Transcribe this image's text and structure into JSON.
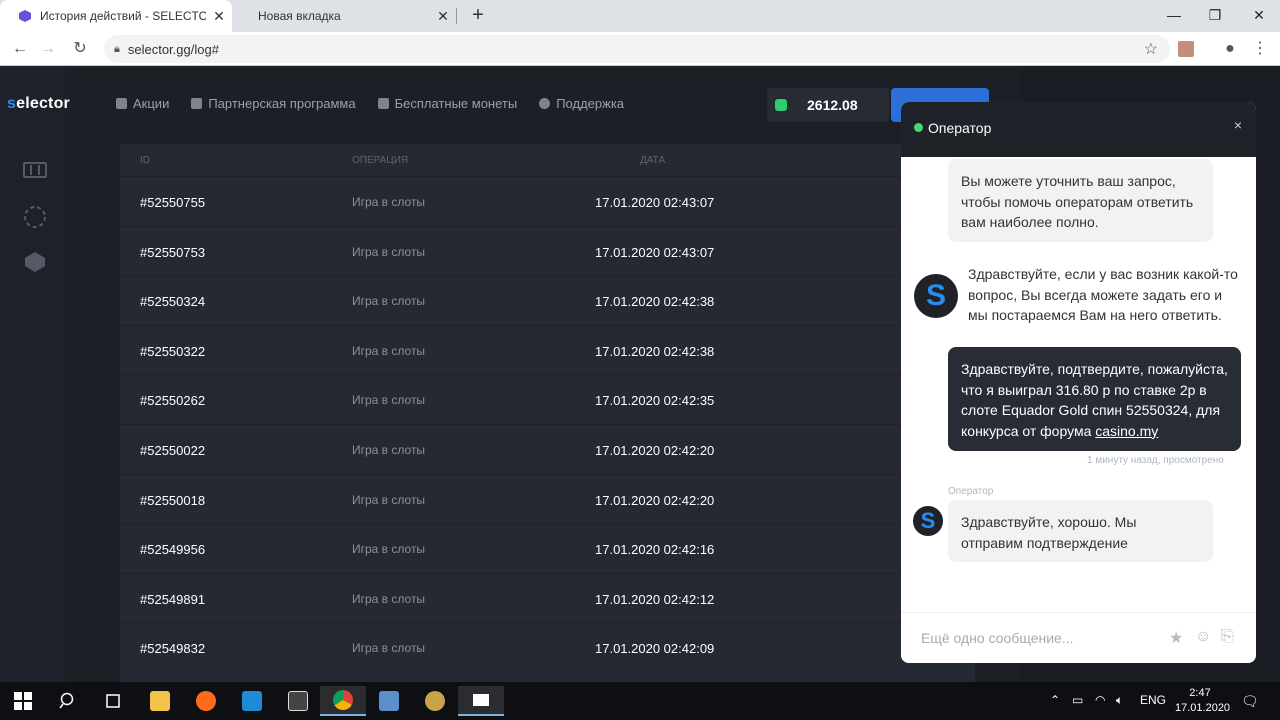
{
  "browser": {
    "tabs": [
      {
        "title": "История действий - SELECTOR.G",
        "active": true
      },
      {
        "title": "Новая вкладка",
        "active": false
      }
    ],
    "url": "selector.gg/log#"
  },
  "site": {
    "logo_prefix": "s",
    "logo_rest": "elector",
    "nav": [
      "Акции",
      "Партнерская программа",
      "Бесплатные монеты",
      "Поддержка"
    ],
    "balance": "2612.08",
    "table": {
      "headers": [
        "ID",
        "ОПЕРАЦИЯ",
        "ДАТА"
      ],
      "rows": [
        {
          "id": "#52550755",
          "op": "Игра в слоты",
          "date": "17.01.2020 02:43:07"
        },
        {
          "id": "#52550753",
          "op": "Игра в слоты",
          "date": "17.01.2020 02:43:07"
        },
        {
          "id": "#52550324",
          "op": "Игра в слоты",
          "date": "17.01.2020 02:42:38"
        },
        {
          "id": "#52550322",
          "op": "Игра в слоты",
          "date": "17.01.2020 02:42:38"
        },
        {
          "id": "#52550262",
          "op": "Игра в слоты",
          "date": "17.01.2020 02:42:35"
        },
        {
          "id": "#52550022",
          "op": "Игра в слоты",
          "date": "17.01.2020 02:42:20"
        },
        {
          "id": "#52550018",
          "op": "Игра в слоты",
          "date": "17.01.2020 02:42:20"
        },
        {
          "id": "#52549956",
          "op": "Игра в слоты",
          "date": "17.01.2020 02:42:16"
        },
        {
          "id": "#52549891",
          "op": "Игра в слоты",
          "date": "17.01.2020 02:42:12"
        },
        {
          "id": "#52549832",
          "op": "Игра в слоты",
          "date": "17.01.2020 02:42:09"
        }
      ]
    }
  },
  "chat": {
    "title": "Оператор",
    "close": "×",
    "msg1": "Вы можете уточнить ваш запрос, чтобы помочь операторам ответить вам наиболее полно.",
    "msg2": "Здравствуйте, если у вас возник какой-то вопрос, Вы всегда можете задать его и мы постараемся Вам на него ответить.",
    "msg3_text": "Здравствуйте, подтвердите, пожалуйста, что я выиграл 316.80 р по ставке 2р в слоте Equador Gold спин 52550324, для конкурса от форума ",
    "msg3_link": "casino.my",
    "msg3_meta": "1 минуту назад, просмотрено",
    "op_label": "Оператор",
    "msg4": "Здравствуйте, хорошо. Мы отправим подтверждение",
    "avatar_letter": "S",
    "input_placeholder": "Ещё одно сообщение..."
  },
  "taskbar": {
    "lang": "ENG",
    "time": "2:47",
    "date": "17.01.2020"
  },
  "colors": {
    "accent": "#2b8cf0",
    "online": "#4cd964",
    "button": "#2b6fd8"
  }
}
